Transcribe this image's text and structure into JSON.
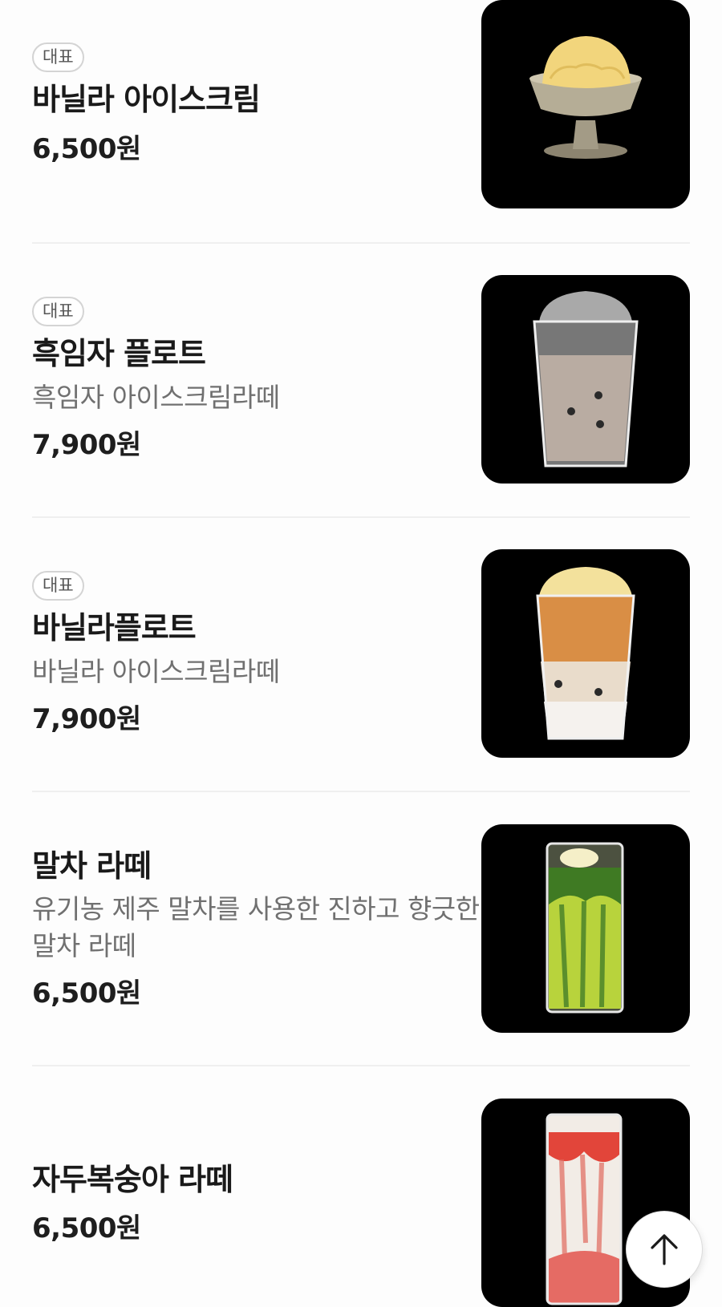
{
  "menu": {
    "items": [
      {
        "badge": "대표",
        "name": "바닐라 아이스크림",
        "description": "",
        "price": "6,500원",
        "image": "vanilla-ice-cream-cup"
      },
      {
        "badge": "대표",
        "name": "흑임자 플로트",
        "description": "흑임자 아이스크림라떼",
        "price": "7,900원",
        "image": "black-sesame-float-glass"
      },
      {
        "badge": "대표",
        "name": "바닐라플로트",
        "description": "바닐라 아이스크림라떼",
        "price": "7,900원",
        "image": "vanilla-float-glass"
      },
      {
        "badge": "",
        "name": "말차 라떼",
        "description": "유기농 제주 말차를 사용한 진하고 향긋한 말차 라떼",
        "price": "6,500원",
        "image": "matcha-latte-glass"
      },
      {
        "badge": "",
        "name": "자두복숭아 라떼",
        "description": "",
        "price": "6,500원",
        "image": "plum-peach-latte-glass"
      }
    ]
  },
  "scroll_top": {
    "icon": "arrow-up-icon"
  }
}
